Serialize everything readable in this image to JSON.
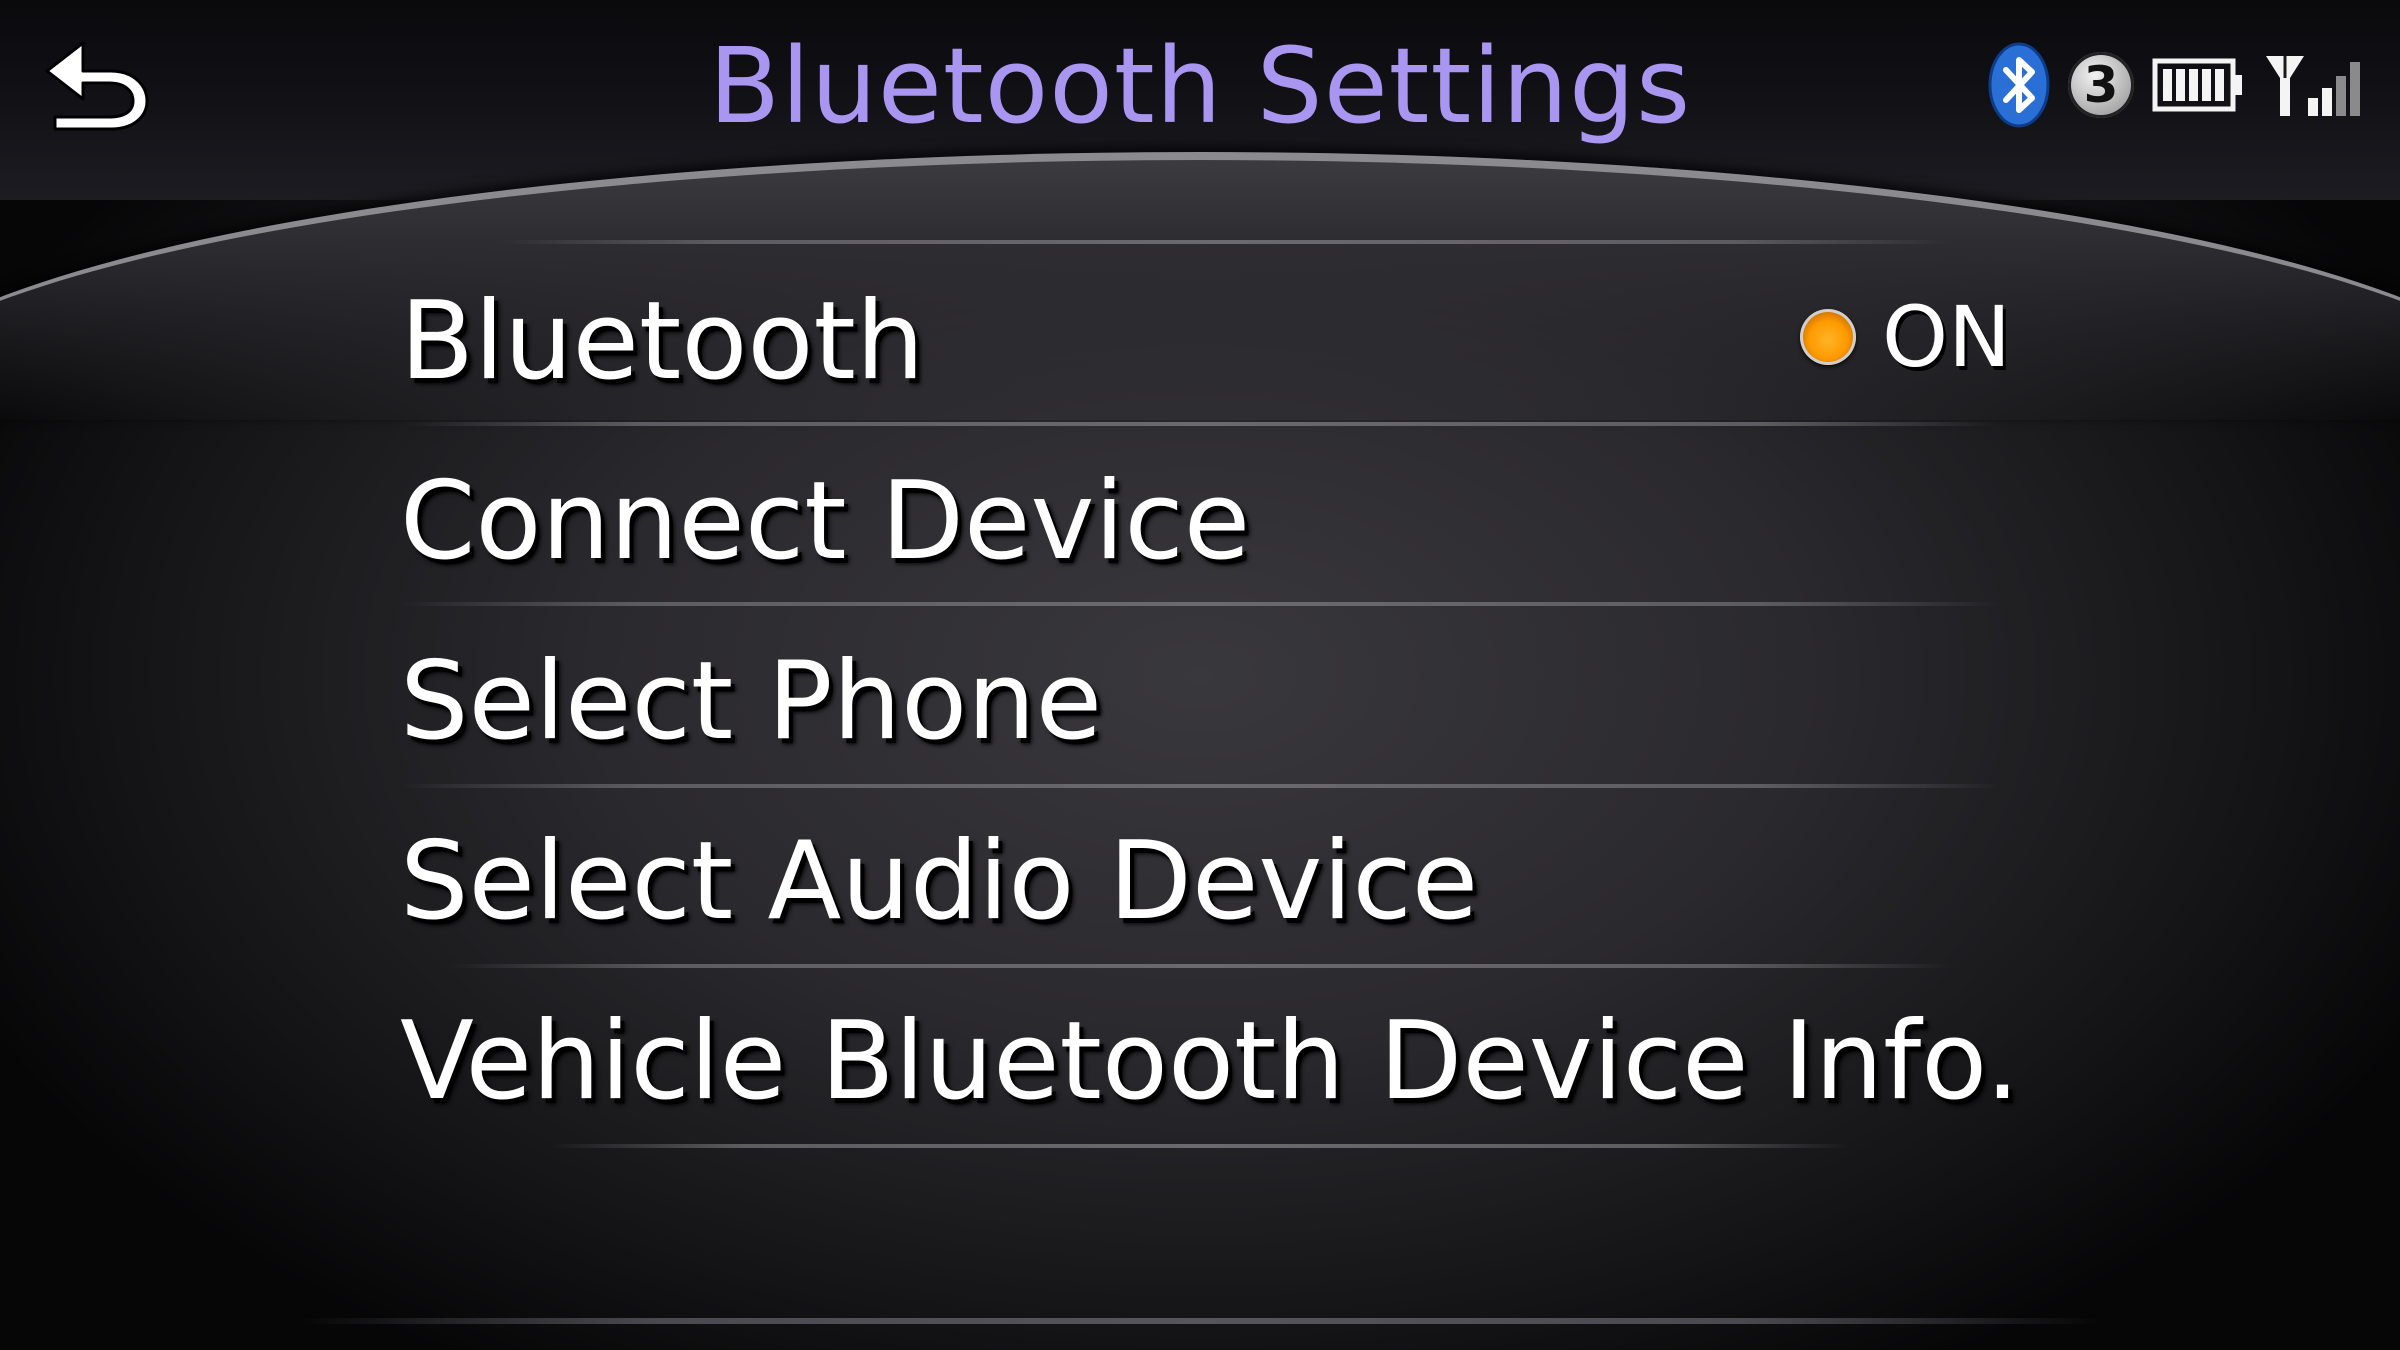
{
  "header": {
    "title": "Bluetooth Settings",
    "back_icon": "back-arrow-icon",
    "status": {
      "bluetooth_icon": "bluetooth-icon",
      "connected_devices": "3",
      "battery_icon": "battery-icon",
      "signal_icon": "signal-strength-icon"
    }
  },
  "menu": {
    "items": [
      {
        "label": "Bluetooth",
        "toggle": {
          "state": "ON",
          "indicator_color": "#ff9a00"
        }
      },
      {
        "label": "Connect Device"
      },
      {
        "label": "Select Phone"
      },
      {
        "label": "Select Audio Device"
      },
      {
        "label": "Vehicle Bluetooth Device Info."
      }
    ]
  },
  "colors": {
    "title": "#a896f0",
    "text": "#ffffff",
    "accent_on": "#ff9a00",
    "bluetooth_badge": "#2a6fd6"
  }
}
